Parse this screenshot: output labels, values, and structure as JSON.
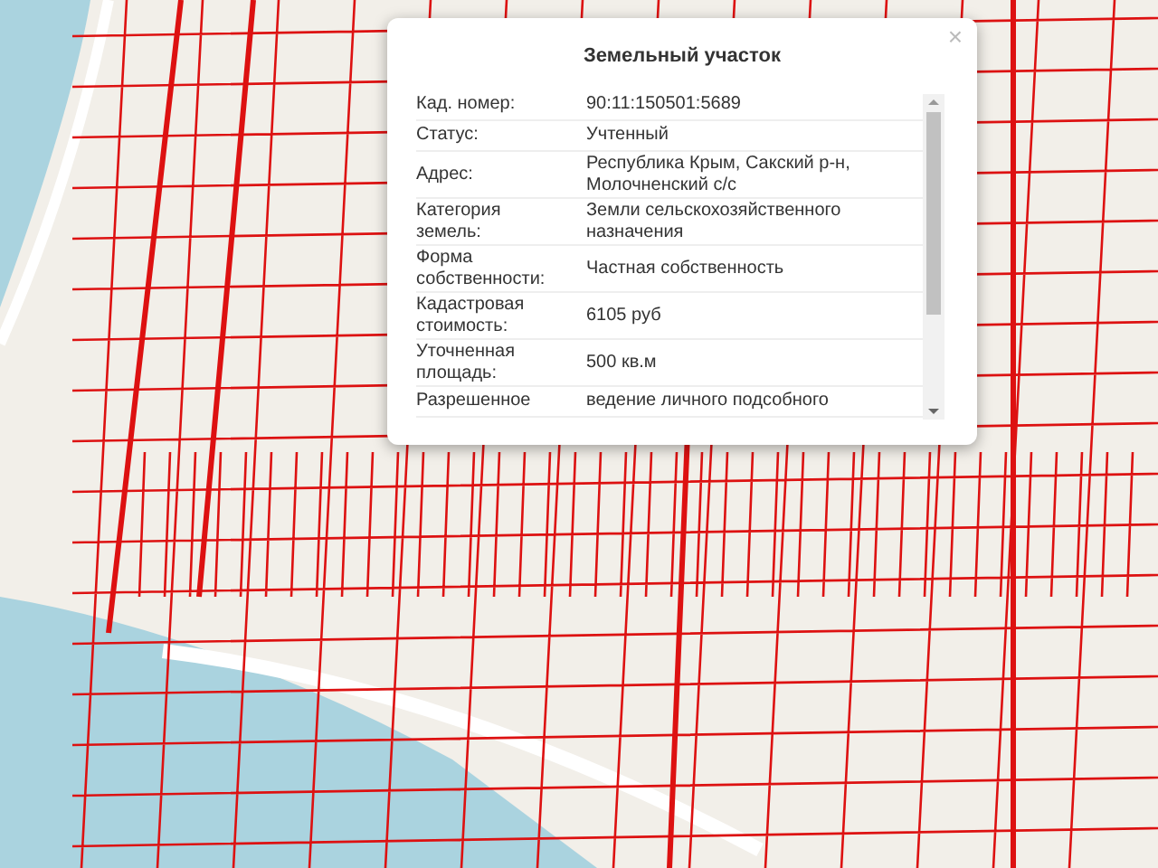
{
  "popup": {
    "title": "Земельный участок",
    "close": "×",
    "rows": [
      {
        "label": "Кад. номер:",
        "value": "90:11:150501:5689"
      },
      {
        "label": "Статус:",
        "value": "Учтенный"
      },
      {
        "label": "Адрес:",
        "value": "Республика Крым, Сакский р-н, Молочненский с/с"
      },
      {
        "label": "Категория земель:",
        "value": "Земли сельскохозяйственного назначения"
      },
      {
        "label": "Форма собственности:",
        "value": "Частная собственность"
      },
      {
        "label": "Кадастровая стоимость:",
        "value": "6105 руб"
      },
      {
        "label": "Уточненная площадь:",
        "value": "500 кв.м"
      },
      {
        "label": "Разрешенное",
        "value": "ведение личного подсобного"
      }
    ]
  }
}
